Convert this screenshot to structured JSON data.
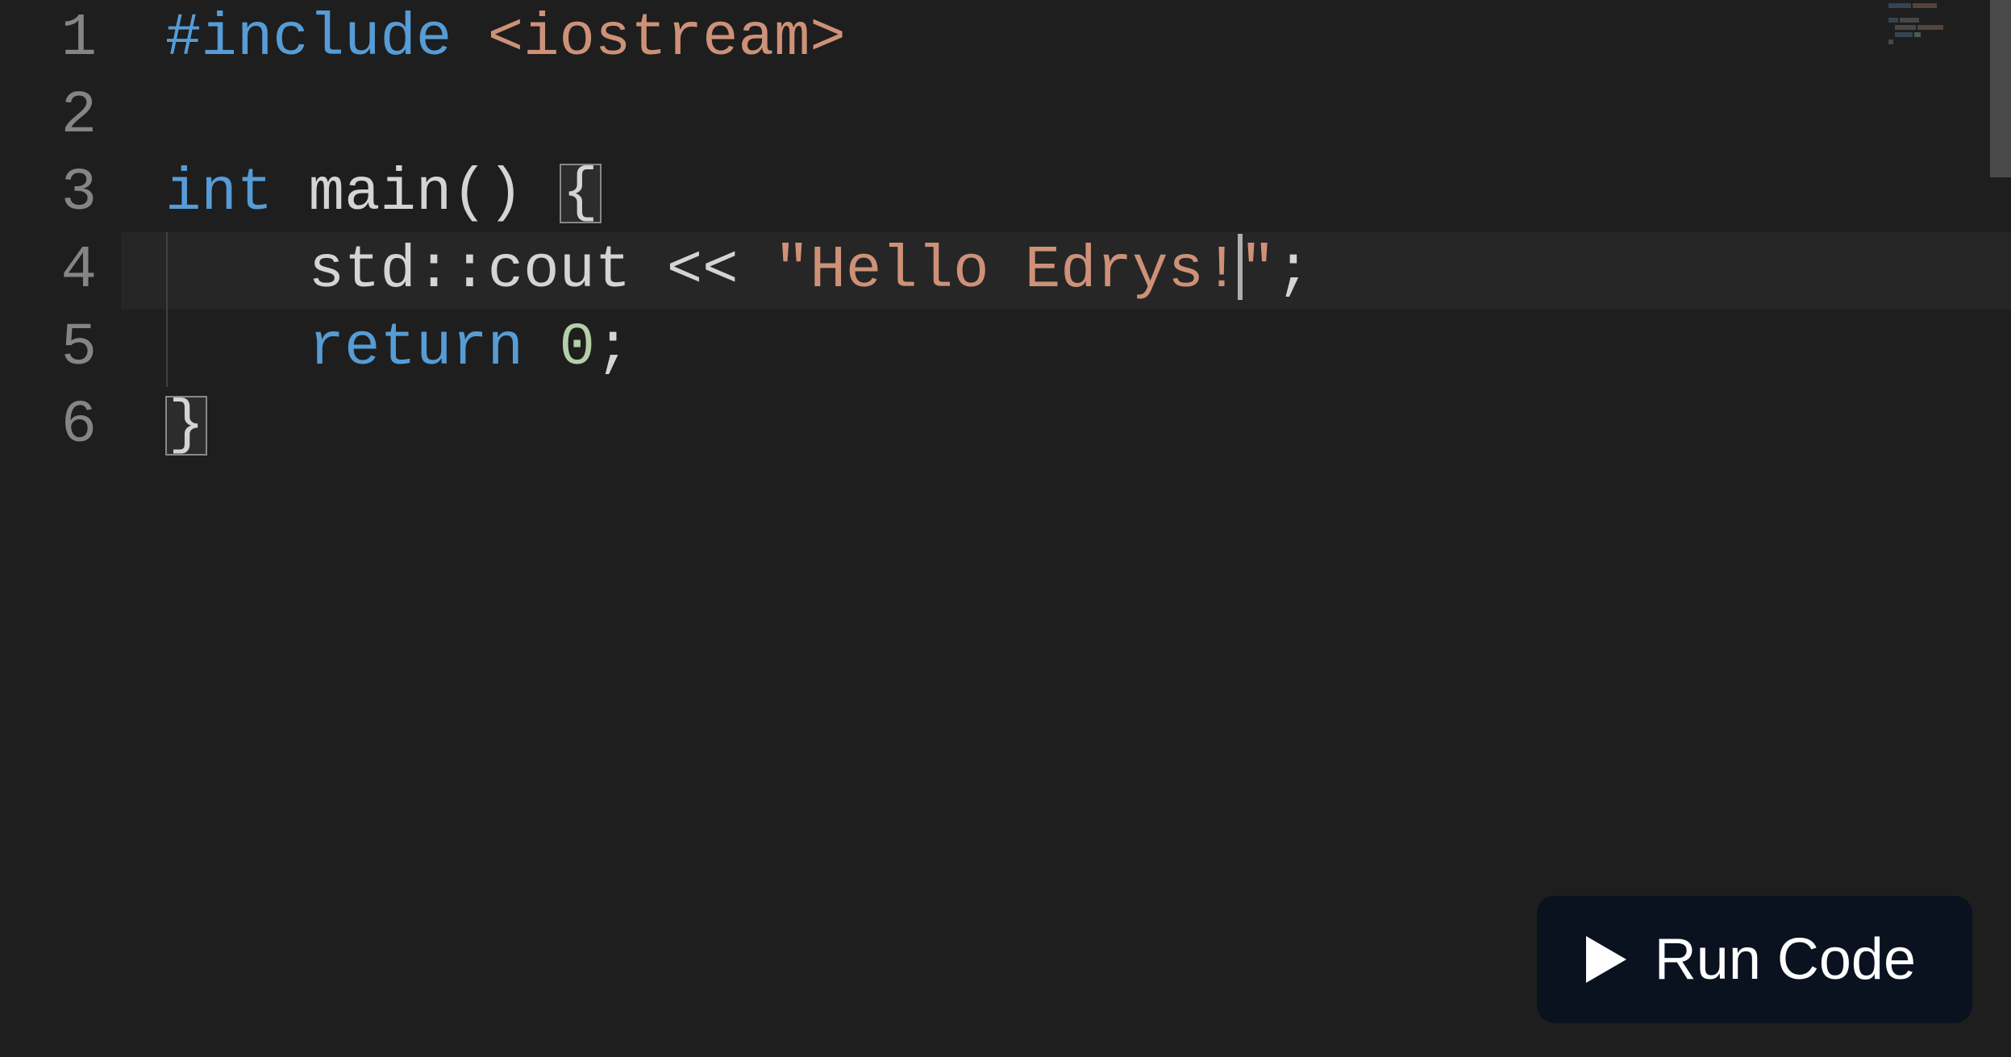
{
  "editor": {
    "lineNumbers": [
      "1",
      "2",
      "3",
      "4",
      "5",
      "6"
    ],
    "activeLine": 4,
    "code": {
      "line1": {
        "preprocessor": "#include",
        "space": " ",
        "path": "<iostream>"
      },
      "line2": "",
      "line3": {
        "keyword": "int",
        "space1": " ",
        "func": "main",
        "parens": "()",
        "space2": " ",
        "brace": "{"
      },
      "line4": {
        "indent": "    ",
        "ns": "std",
        "scope": "::",
        "obj": "cout",
        "space1": " ",
        "op": "<<",
        "space2": " ",
        "quote1": "\"",
        "string_body": "Hello Edrys!",
        "quote2": "\"",
        "semi": ";"
      },
      "line5": {
        "indent": "    ",
        "keyword": "return",
        "space": " ",
        "number": "0",
        "semi": ";"
      },
      "line6": {
        "brace": "}"
      }
    }
  },
  "runButton": {
    "label": "Run Code"
  }
}
